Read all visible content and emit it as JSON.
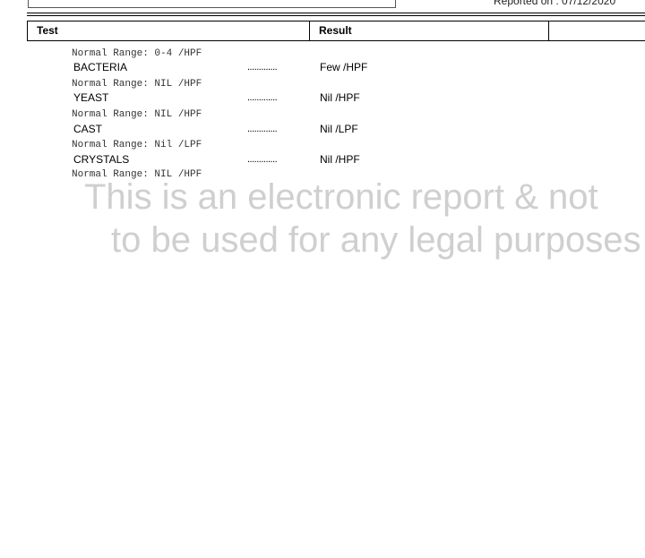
{
  "header_strip": {
    "reported_on_label": "Reported on",
    "reported_on_value": ": 07/12/2020"
  },
  "table": {
    "columns": [
      "Test",
      "Result",
      ""
    ]
  },
  "rows": [
    {
      "range": "Normal Range: 0-4 /HPF"
    },
    {
      "name": "BACTERIA",
      "dots": ".............",
      "result": "Few /HPF",
      "range": "Normal Range: NIL /HPF"
    },
    {
      "name": "YEAST",
      "dots": ".............",
      "result": "Nil /HPF",
      "range": "Normal Range: NIL /HPF"
    },
    {
      "name": "CAST",
      "dots": ".............",
      "result": "Nil /LPF",
      "range": "Normal Range: Nil /LPF"
    },
    {
      "name": "CRYSTALS",
      "dots": ".............",
      "result": "Nil /HPF",
      "range": "Normal Range: NIL /HPF"
    }
  ],
  "watermark": {
    "line1": "This is an electronic report & not",
    "line2": "to be used for any legal purposes"
  }
}
